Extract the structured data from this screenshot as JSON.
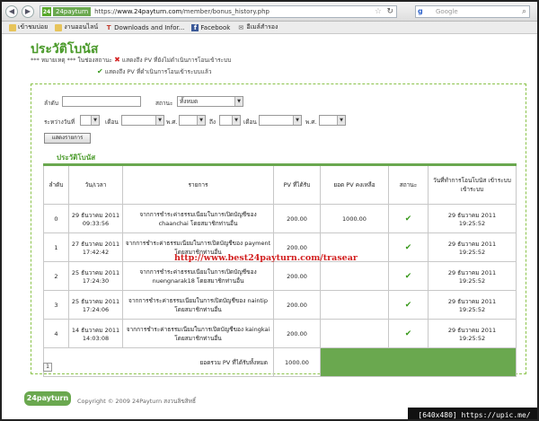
{
  "browser": {
    "url_badge": "24payturn",
    "url_prefix": "https://",
    "url_host": "www.24payturn.com",
    "url_path": "/member/bonus_history.php",
    "search_placeholder": "Google",
    "bookmarks": [
      {
        "label": "เข้าชมบ่อย",
        "icon": "bookmark-icon"
      },
      {
        "label": "งานออนไลน์",
        "icon": "folder-icon"
      },
      {
        "label": "Downloads and Infor...",
        "icon": "tv-icon"
      },
      {
        "label": "Facebook",
        "icon": "facebook-icon"
      },
      {
        "label": "อีเมล์สำรอง",
        "icon": "mail-icon"
      }
    ]
  },
  "page": {
    "title": "ประวัติโบนัส",
    "legend_note": "*** หมายเหตุ *** ในช่องสถานะ",
    "legend_x_text": "แสดงถึง PV ที่ยังไม่ดำเนินการโอนเข้าระบบ",
    "legend_check_text": "แสดงถึง PV ที่ดำเนินการโอนเข้าระบบแล้ว"
  },
  "filters": {
    "sequence_label": "ลำดับ",
    "status_label": "สถานะ",
    "status_value": "ทั้งหมด",
    "between_day_label": "ระหว่างวันที่",
    "month_label": "เดือน",
    "year_label": "พ.ศ.",
    "to_label": "ถึง",
    "show_button": "แสดงรายการ"
  },
  "table": {
    "section_title": "ประวัติโบนัส",
    "headers": [
      "ลำดับ",
      "วัน/เวลา",
      "รายการ",
      "PV ที่ได้รับ",
      "ยอด PV คงเหลือ",
      "สถานะ",
      "วันที่ทำการโอนโบนัส เข้าระบบ เข้าระบบ"
    ],
    "rows": [
      {
        "idx": "0",
        "date": "29 ธันวาคม 2011",
        "time": "09:33:56",
        "desc1": "จากการชำระค่าธรรมเนียมในการเปิดบัญชีของ",
        "desc2": "chaanchai โดยสมาชิกท่านอื่น",
        "pv": "200.00",
        "balance": "1000.00",
        "status": "✔",
        "tdate": "29 ธันวาคม 2011",
        "ttime": "19:25:52"
      },
      {
        "idx": "1",
        "date": "27 ธันวาคม 2011",
        "time": "17:42:42",
        "desc1": "จากการชำระค่าธรรมเนียมในการเปิดบัญชีของ payment",
        "desc2": "โดยสมาชิกท่านอื่น",
        "pv": "200.00",
        "balance": "",
        "status": "✔",
        "tdate": "29 ธันวาคม 2011",
        "ttime": "19:25:52"
      },
      {
        "idx": "2",
        "date": "25 ธันวาคม 2011",
        "time": "17:24:30",
        "desc1": "จากการชำระค่าธรรมเนียมในการเปิดบัญชีของ",
        "desc2": "nuengnarak18 โดยสมาชิกท่านอื่น",
        "pv": "200.00",
        "balance": "",
        "status": "✔",
        "tdate": "29 ธันวาคม 2011",
        "ttime": "19:25:52"
      },
      {
        "idx": "3",
        "date": "25 ธันวาคม 2011",
        "time": "17:24:06",
        "desc1": "จากการชำระค่าธรรมเนียมในการเปิดบัญชีของ naintip",
        "desc2": "โดยสมาชิกท่านอื่น",
        "pv": "200.00",
        "balance": "",
        "status": "✔",
        "tdate": "29 ธันวาคม 2011",
        "ttime": "19:25:52"
      },
      {
        "idx": "4",
        "date": "14 ธันวาคม 2011",
        "time": "14:03:08",
        "desc1": "จากการชำระค่าธรรมเนียมในการเปิดบัญชีของ kaingkai",
        "desc2": "โดยสมาชิกท่านอื่น",
        "pv": "200.00",
        "balance": "",
        "status": "✔",
        "tdate": "29 ธันวาคม 2011",
        "ttime": "19:25:52"
      }
    ],
    "total_label": "ยอดรวม PV ที่ได้รับทั้งหมด",
    "total_value": "1000.00",
    "page_number": "1"
  },
  "watermark": "http://www.best24payturn.com/trasear",
  "footer": {
    "logo": "24payturn",
    "copyright": "Copyright © 2009 24Payturn สงวนลิขสิทธิ์"
  },
  "overlay": "[640x480] https://upic.me/",
  "colors": {
    "accent_green": "#6aa84f",
    "title_green": "#4a9a2a",
    "error_red": "#d42323"
  }
}
